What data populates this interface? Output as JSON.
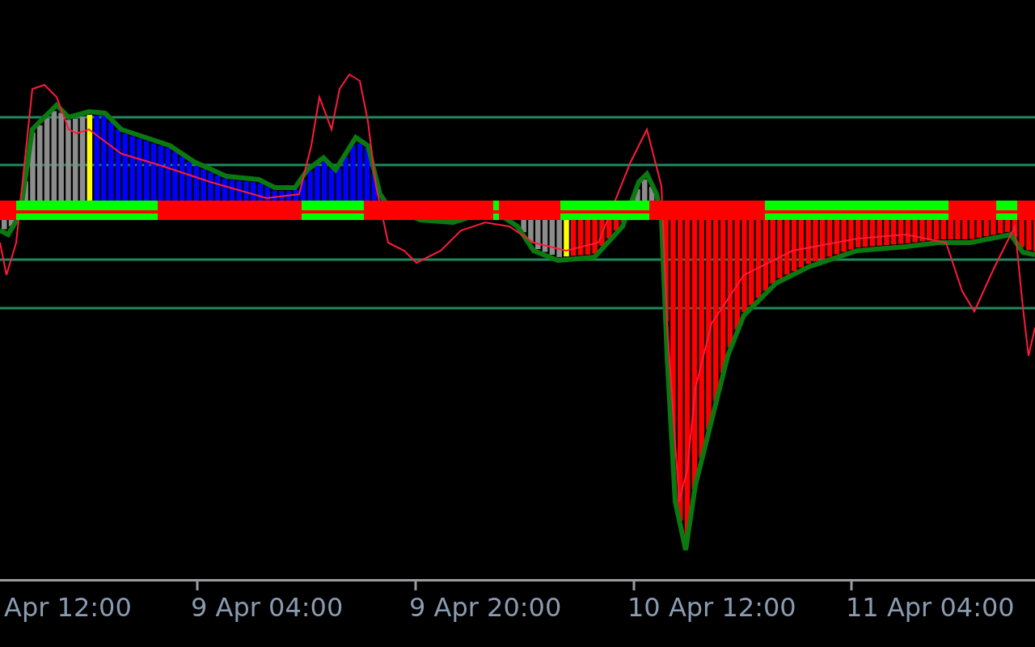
{
  "time_axis": {
    "labels": [
      "Apr 12:00",
      "9 Apr 04:00",
      "9 Apr 20:00",
      "10 Apr 12:00",
      "11 Apr 04:00"
    ]
  }
}
